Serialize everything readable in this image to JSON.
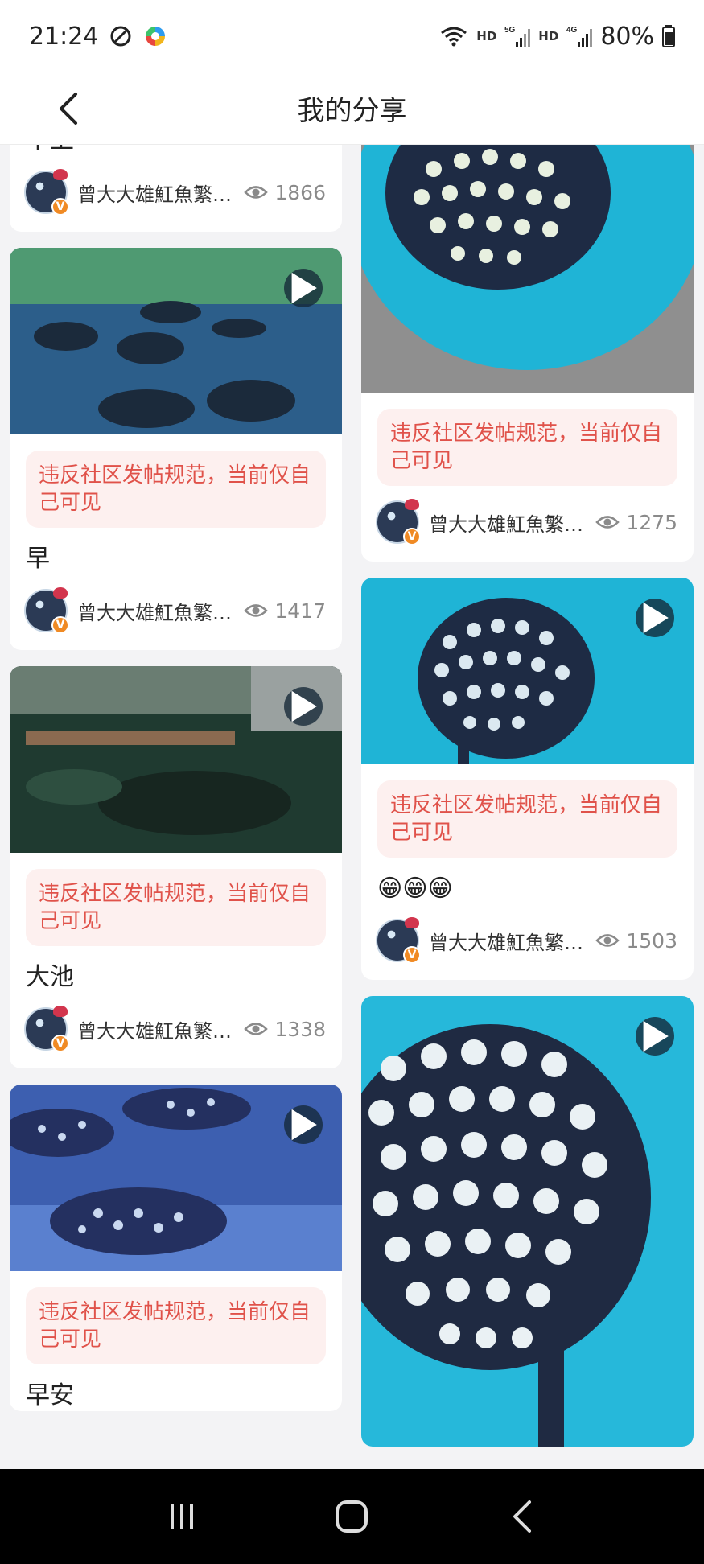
{
  "status_bar": {
    "time": "21:24",
    "net1_label": "HD",
    "net2_top": "5G",
    "net2_label": "HD",
    "net3_top": "4G",
    "battery": "80%"
  },
  "header": {
    "title": "我的分享",
    "back_icon": "chevron-left-icon"
  },
  "warning_text": "违反社区发帖规范，当前仅自己可见",
  "author_name": "曾大大雄魟魚繁殖場",
  "author_badge": "V",
  "left_column": [
    {
      "caption": "早上",
      "views": "1866"
    },
    {
      "caption": "早",
      "views": "1417"
    },
    {
      "caption": "大池",
      "views": "1338"
    },
    {
      "caption": "早安",
      "views": ""
    }
  ],
  "right_column": [
    {
      "caption": "",
      "views": "1275"
    },
    {
      "caption": "😁😁😁",
      "views": "1503"
    },
    {
      "caption": "",
      "views": ""
    }
  ],
  "colors": {
    "warning_text": "#e0524a",
    "warning_bg": "#fdf0ef",
    "teal_water": "#1fb4d6",
    "badge_orange": "#f08a24"
  },
  "navbar": {
    "recent_icon": "recent-apps-icon",
    "home_icon": "home-icon",
    "back_icon": "back-icon"
  }
}
